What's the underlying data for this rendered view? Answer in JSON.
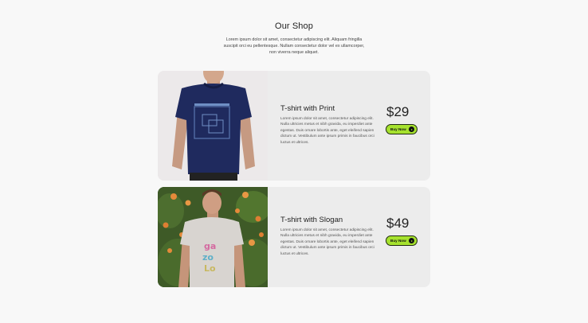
{
  "shop": {
    "title": "Our Shop",
    "subtitle": "Lorem ipsum dolor sit amet, consectetur adipiscing elit. Aliquam fringilla suscipit orci eu pellentesque. Nullam consectetur dolor vel ex ullamcorper, non viverra neque aliquet."
  },
  "products": [
    {
      "name": "T-shirt with Print",
      "description": "Lorem ipsum dolor sit amet, consectetur adipiscing elit. Nulla ultricies metus et nibh gravida, eu imperdiet ante egestas. Duis ornare lobortis ante, eget eleifend sapien dictum ut. Vestibulum ante ipsum primis in faucibus orci luctus et ultrices.",
      "price": "$29",
      "button_label": "Buy Now"
    },
    {
      "name": "T-shirt with Slogan",
      "description": "Lorem ipsum dolor sit amet, consectetur adipiscing elit. Nulla ultricies metus et nibh gravida, eu imperdiet ante egestas. Duis ornare lobortis ante, eget eleifend sapien dictum ut. Vestibulum ante ipsum primis in faucibus orci luctus et ultrices.",
      "price": "$49",
      "button_label": "Buy Now"
    }
  ],
  "colors": {
    "page_background": "#f8f8f8",
    "card_background": "#ececec",
    "button_accent": "#a6e22e",
    "text": "#222222"
  },
  "icons": {
    "buy_button_icon": "arrow-right-circle-icon"
  }
}
